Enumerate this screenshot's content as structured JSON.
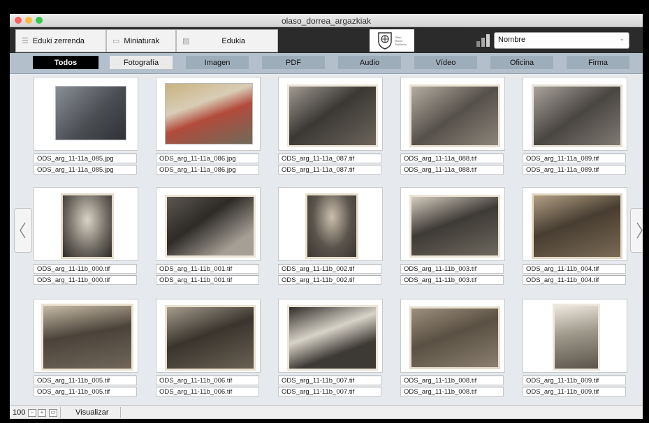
{
  "window": {
    "title": "olaso_dorrea_argazkiak"
  },
  "view_tabs": [
    {
      "label": "Eduki zerrenda",
      "icon": "list-icon"
    },
    {
      "label": "Miniaturak",
      "icon": "thumbnails-icon"
    },
    {
      "label": "Edukia",
      "icon": "content-icon"
    }
  ],
  "logo": {
    "line1": "Olaso",
    "line2": "Dorrea",
    "line3": "Fundazioa"
  },
  "sort": {
    "selected": "Nombre",
    "icon": "bar-chart-icon"
  },
  "filters": [
    {
      "label": "Todos",
      "state": "active"
    },
    {
      "label": "Fotografía",
      "state": "light"
    },
    {
      "label": "Imagen",
      "state": "normal"
    },
    {
      "label": "PDF",
      "state": "normal"
    },
    {
      "label": "Audio",
      "state": "normal"
    },
    {
      "label": "Vídeo",
      "state": "normal"
    },
    {
      "label": "Oficina",
      "state": "normal"
    },
    {
      "label": "Firma",
      "state": "normal"
    }
  ],
  "items": [
    {
      "name1": "ODS_arg_11-11a_085.jpg",
      "name2": "ODS_arg_11-11a_085.jpg"
    },
    {
      "name1": "ODS_arg_11-11a_086.jpg",
      "name2": "ODS_arg_11-11a_086.jpg"
    },
    {
      "name1": "ODS_arg_11-11a_087.tif",
      "name2": "ODS_arg_11-11a_087.tif"
    },
    {
      "name1": "ODS_arg_11-11a_088.tif",
      "name2": "ODS_arg_11-11a_088.tif"
    },
    {
      "name1": "ODS_arg_11-11a_089.tif",
      "name2": "ODS_arg_11-11a_089.tif"
    },
    {
      "name1": "ODS_arg_11-11b_000.tif",
      "name2": "ODS_arg_11-11b_000.tif"
    },
    {
      "name1": "ODS_arg_11-11b_001.tif",
      "name2": "ODS_arg_11-11b_001.tif"
    },
    {
      "name1": "ODS_arg_11-11b_002.tif",
      "name2": "ODS_arg_11-11b_002.tif"
    },
    {
      "name1": "ODS_arg_11-11b_003.tif",
      "name2": "ODS_arg_11-11b_003.tif"
    },
    {
      "name1": "ODS_arg_11-11b_004.tif",
      "name2": "ODS_arg_11-11b_004.tif"
    },
    {
      "name1": "ODS_arg_11-11b_005.tif",
      "name2": "ODS_arg_11-11b_005.tif"
    },
    {
      "name1": "ODS_arg_11-11b_006.tif",
      "name2": "ODS_arg_11-11b_006.tif"
    },
    {
      "name1": "ODS_arg_11-11b_007.tif",
      "name2": "ODS_arg_11-11b_007.tif"
    },
    {
      "name1": "ODS_arg_11-11b_008.tif",
      "name2": "ODS_arg_11-11b_008.tif"
    },
    {
      "name1": "ODS_arg_11-11b_009.tif",
      "name2": "ODS_arg_11-11b_009.tif"
    }
  ],
  "status": {
    "zoom": "100",
    "view_label": "Visualizar"
  }
}
